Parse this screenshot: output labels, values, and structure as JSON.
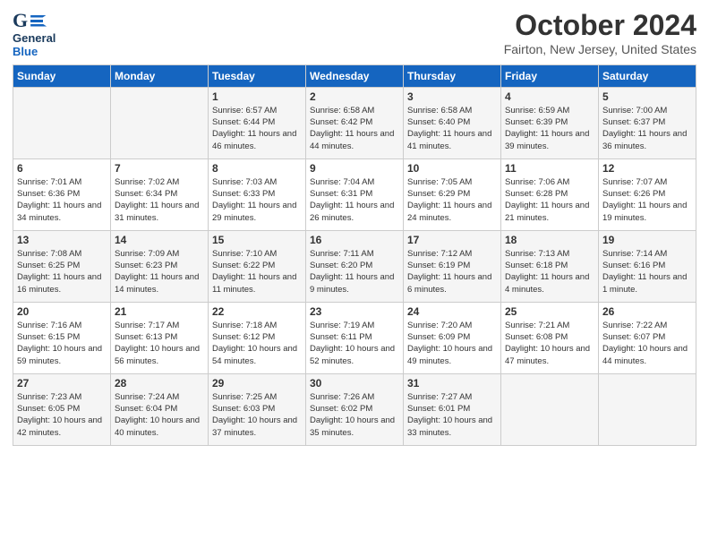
{
  "header": {
    "logo_line1": "General",
    "logo_line2": "Blue",
    "title": "October 2024",
    "subtitle": "Fairton, New Jersey, United States"
  },
  "calendar": {
    "days_of_week": [
      "Sunday",
      "Monday",
      "Tuesday",
      "Wednesday",
      "Thursday",
      "Friday",
      "Saturday"
    ],
    "weeks": [
      [
        {
          "day": "",
          "info": ""
        },
        {
          "day": "",
          "info": ""
        },
        {
          "day": "1",
          "info": "Sunrise: 6:57 AM\nSunset: 6:44 PM\nDaylight: 11 hours and 46 minutes."
        },
        {
          "day": "2",
          "info": "Sunrise: 6:58 AM\nSunset: 6:42 PM\nDaylight: 11 hours and 44 minutes."
        },
        {
          "day": "3",
          "info": "Sunrise: 6:58 AM\nSunset: 6:40 PM\nDaylight: 11 hours and 41 minutes."
        },
        {
          "day": "4",
          "info": "Sunrise: 6:59 AM\nSunset: 6:39 PM\nDaylight: 11 hours and 39 minutes."
        },
        {
          "day": "5",
          "info": "Sunrise: 7:00 AM\nSunset: 6:37 PM\nDaylight: 11 hours and 36 minutes."
        }
      ],
      [
        {
          "day": "6",
          "info": "Sunrise: 7:01 AM\nSunset: 6:36 PM\nDaylight: 11 hours and 34 minutes."
        },
        {
          "day": "7",
          "info": "Sunrise: 7:02 AM\nSunset: 6:34 PM\nDaylight: 11 hours and 31 minutes."
        },
        {
          "day": "8",
          "info": "Sunrise: 7:03 AM\nSunset: 6:33 PM\nDaylight: 11 hours and 29 minutes."
        },
        {
          "day": "9",
          "info": "Sunrise: 7:04 AM\nSunset: 6:31 PM\nDaylight: 11 hours and 26 minutes."
        },
        {
          "day": "10",
          "info": "Sunrise: 7:05 AM\nSunset: 6:29 PM\nDaylight: 11 hours and 24 minutes."
        },
        {
          "day": "11",
          "info": "Sunrise: 7:06 AM\nSunset: 6:28 PM\nDaylight: 11 hours and 21 minutes."
        },
        {
          "day": "12",
          "info": "Sunrise: 7:07 AM\nSunset: 6:26 PM\nDaylight: 11 hours and 19 minutes."
        }
      ],
      [
        {
          "day": "13",
          "info": "Sunrise: 7:08 AM\nSunset: 6:25 PM\nDaylight: 11 hours and 16 minutes."
        },
        {
          "day": "14",
          "info": "Sunrise: 7:09 AM\nSunset: 6:23 PM\nDaylight: 11 hours and 14 minutes."
        },
        {
          "day": "15",
          "info": "Sunrise: 7:10 AM\nSunset: 6:22 PM\nDaylight: 11 hours and 11 minutes."
        },
        {
          "day": "16",
          "info": "Sunrise: 7:11 AM\nSunset: 6:20 PM\nDaylight: 11 hours and 9 minutes."
        },
        {
          "day": "17",
          "info": "Sunrise: 7:12 AM\nSunset: 6:19 PM\nDaylight: 11 hours and 6 minutes."
        },
        {
          "day": "18",
          "info": "Sunrise: 7:13 AM\nSunset: 6:18 PM\nDaylight: 11 hours and 4 minutes."
        },
        {
          "day": "19",
          "info": "Sunrise: 7:14 AM\nSunset: 6:16 PM\nDaylight: 11 hours and 1 minute."
        }
      ],
      [
        {
          "day": "20",
          "info": "Sunrise: 7:16 AM\nSunset: 6:15 PM\nDaylight: 10 hours and 59 minutes."
        },
        {
          "day": "21",
          "info": "Sunrise: 7:17 AM\nSunset: 6:13 PM\nDaylight: 10 hours and 56 minutes."
        },
        {
          "day": "22",
          "info": "Sunrise: 7:18 AM\nSunset: 6:12 PM\nDaylight: 10 hours and 54 minutes."
        },
        {
          "day": "23",
          "info": "Sunrise: 7:19 AM\nSunset: 6:11 PM\nDaylight: 10 hours and 52 minutes."
        },
        {
          "day": "24",
          "info": "Sunrise: 7:20 AM\nSunset: 6:09 PM\nDaylight: 10 hours and 49 minutes."
        },
        {
          "day": "25",
          "info": "Sunrise: 7:21 AM\nSunset: 6:08 PM\nDaylight: 10 hours and 47 minutes."
        },
        {
          "day": "26",
          "info": "Sunrise: 7:22 AM\nSunset: 6:07 PM\nDaylight: 10 hours and 44 minutes."
        }
      ],
      [
        {
          "day": "27",
          "info": "Sunrise: 7:23 AM\nSunset: 6:05 PM\nDaylight: 10 hours and 42 minutes."
        },
        {
          "day": "28",
          "info": "Sunrise: 7:24 AM\nSunset: 6:04 PM\nDaylight: 10 hours and 40 minutes."
        },
        {
          "day": "29",
          "info": "Sunrise: 7:25 AM\nSunset: 6:03 PM\nDaylight: 10 hours and 37 minutes."
        },
        {
          "day": "30",
          "info": "Sunrise: 7:26 AM\nSunset: 6:02 PM\nDaylight: 10 hours and 35 minutes."
        },
        {
          "day": "31",
          "info": "Sunrise: 7:27 AM\nSunset: 6:01 PM\nDaylight: 10 hours and 33 minutes."
        },
        {
          "day": "",
          "info": ""
        },
        {
          "day": "",
          "info": ""
        }
      ]
    ]
  }
}
